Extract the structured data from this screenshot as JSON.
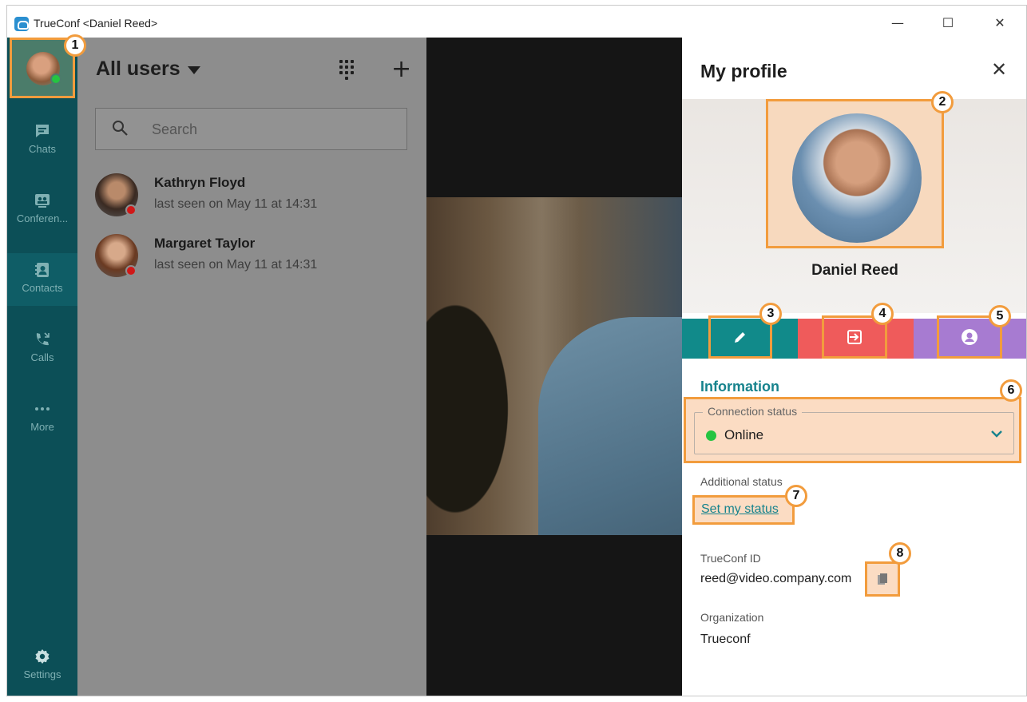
{
  "window": {
    "title": "TrueConf <Daniel Reed>",
    "minimize": "—",
    "maximize": "☐",
    "close": "✕"
  },
  "sidebar": {
    "avatar_status_color": "#25c441",
    "items": [
      {
        "label": "Chats",
        "icon": "chat-icon"
      },
      {
        "label": "Conferen...",
        "icon": "conference-icon"
      },
      {
        "label": "Contacts",
        "icon": "contacts-icon"
      },
      {
        "label": "Calls",
        "icon": "calls-icon"
      },
      {
        "label": "More",
        "icon": "more-icon"
      },
      {
        "label": "Settings",
        "icon": "gear-icon"
      }
    ],
    "active": "Contacts"
  },
  "contacts": {
    "filter_label": "All users",
    "search_placeholder": "Search",
    "add_symbol": "+",
    "list": [
      {
        "name": "Kathryn Floyd",
        "status": "last seen on May 11 at 14:31"
      },
      {
        "name": "Margaret Taylor",
        "status": "last seen on May 11 at 14:31"
      }
    ]
  },
  "profile": {
    "title": "My profile",
    "close_symbol": "✕",
    "name": "Daniel Reed",
    "action_colors": [
      "#118a8a",
      "#ef5b5b",
      "#a77bd1"
    ],
    "information_heading": "Information",
    "connection_status_label": "Connection status",
    "connection_status_value": "Online",
    "connection_status_color": "#25c441",
    "additional_status_label": "Additional status",
    "set_status_link": "Set my status",
    "trueconf_id_label": "TrueConf ID",
    "trueconf_id_value": "reed@video.company.com",
    "organization_label": "Organization",
    "organization_value": "Trueconf"
  },
  "markers": [
    "1",
    "2",
    "3",
    "4",
    "5",
    "6",
    "7",
    "8"
  ],
  "accent_color": "#f29c3d"
}
